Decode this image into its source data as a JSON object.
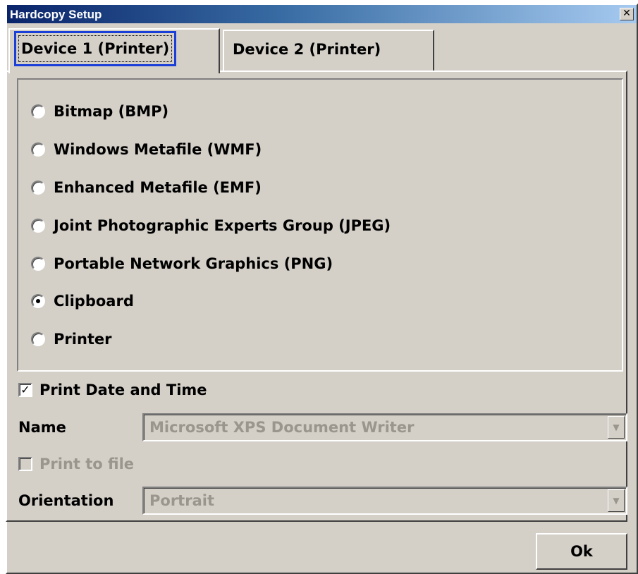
{
  "window": {
    "title": "Hardcopy Setup",
    "close_glyph": "✕"
  },
  "tabs": [
    {
      "label": "Device 1 (Printer)",
      "active": true
    },
    {
      "label": "Device 2 (Printer)",
      "active": false
    }
  ],
  "output_options": [
    {
      "label": "Bitmap (BMP)",
      "selected": false
    },
    {
      "label": "Windows Metafile (WMF)",
      "selected": false
    },
    {
      "label": "Enhanced Metafile (EMF)",
      "selected": false
    },
    {
      "label": "Joint Photographic Experts Group (JPEG)",
      "selected": false
    },
    {
      "label": "Portable Network Graphics (PNG)",
      "selected": false
    },
    {
      "label": "Clipboard",
      "selected": true
    },
    {
      "label": "Printer",
      "selected": false
    }
  ],
  "print_date_time": {
    "label": "Print Date and Time",
    "checked": true,
    "check_glyph": "✓"
  },
  "name": {
    "label": "Name",
    "value": "Microsoft XPS Document Writer",
    "arrow_glyph": "▼"
  },
  "print_to_file": {
    "label": "Print to file",
    "checked": false
  },
  "orientation": {
    "label": "Orientation",
    "value": "Portrait",
    "arrow_glyph": "▼"
  },
  "ok_button": {
    "label": "Ok"
  },
  "colors": {
    "title_gradient_start": "#0a246a",
    "dialog_face": "#d4d0c8",
    "focus_outline": "#1a3fd8",
    "disabled_text": "#9a968e"
  }
}
